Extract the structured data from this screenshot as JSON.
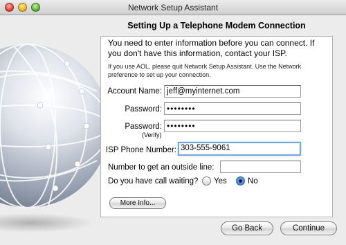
{
  "window": {
    "title": "Network Setup Assistant"
  },
  "page": {
    "heading": "Setting Up a Telephone Modem Connection",
    "intro": "You need to enter information before you can connect. If you don't have this information, contact your ISP.",
    "note": "If you use AOL, please quit Network Setup Assistant. Use the Network preference to set up your connection."
  },
  "form": {
    "account_label": "Account Name:",
    "account_value": "jeff@myinternet.com",
    "password_label": "Password:",
    "password_value": "••••••••",
    "verify_label": "Password:",
    "verify_sub": "(Verify)",
    "verify_value": "••••••••",
    "phone_label": "ISP Phone Number:",
    "phone_value": "303-555-9061",
    "outside_label": "Number to get an outside line:",
    "outside_value": "",
    "waiting_label": "Do you have call waiting?",
    "yes_label": "Yes",
    "no_label": "No",
    "waiting_selected": "No"
  },
  "buttons": {
    "more_info": "More Info...",
    "go_back": "Go Back",
    "continue": "Continue"
  },
  "colors": {
    "focus_ring": "#74a6e0",
    "radio_selected": "#3f7fd0"
  }
}
